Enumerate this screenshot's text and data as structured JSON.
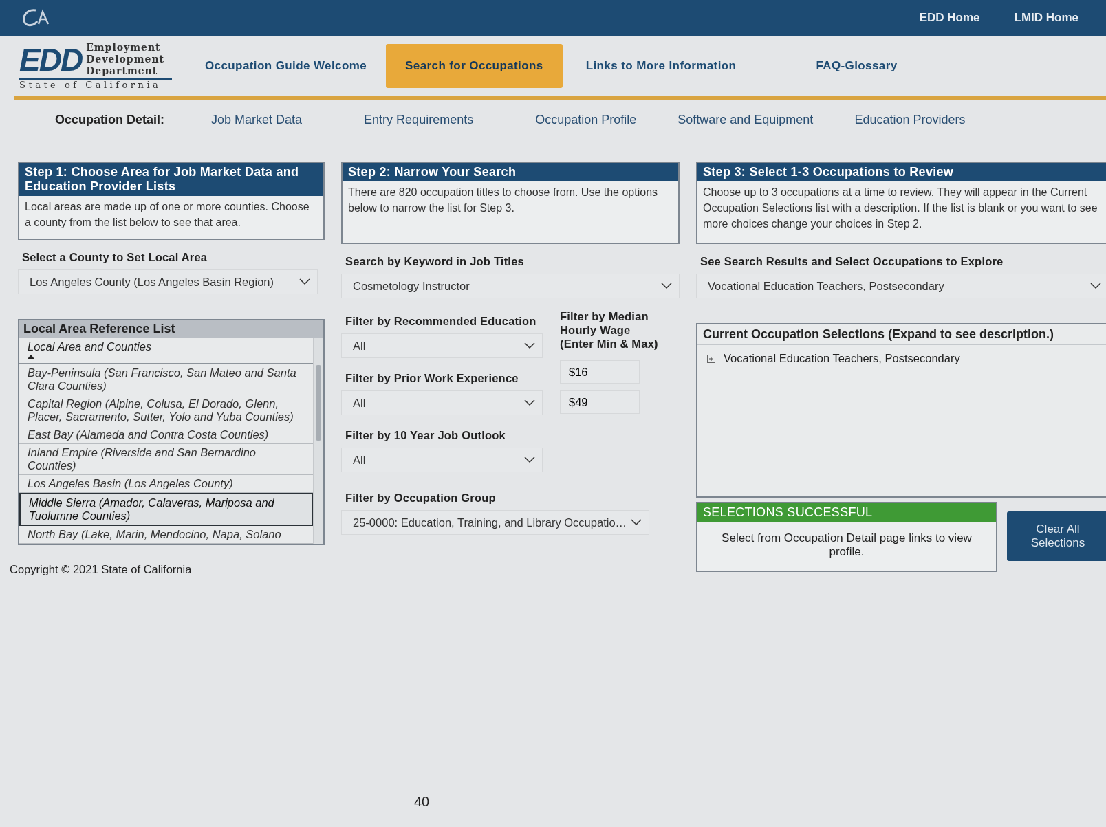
{
  "header": {
    "links": [
      "EDD Home",
      "LMID Home"
    ]
  },
  "logo": {
    "initials": "EDD",
    "lines": [
      "Employment",
      "Development",
      "Department"
    ],
    "tagline": "State of California"
  },
  "nav": [
    {
      "label": "Occupation Guide Welcome",
      "selected": false
    },
    {
      "label": "Search for Occupations",
      "selected": true
    },
    {
      "label": "Links to More Information",
      "selected": false
    },
    {
      "label": "FAQ-Glossary",
      "selected": false
    }
  ],
  "detail_nav": {
    "label": "Occupation Detail:",
    "links": [
      "Job Market Data",
      "Entry Requirements",
      "Occupation Profile",
      "Software and Equipment",
      "Education Providers"
    ]
  },
  "step1": {
    "title": "Step 1: Choose Area for Job Market Data and Education Provider Lists",
    "text": "Local areas are made up of one or more counties. Choose a county from the list below to see that area.",
    "county_label": "Select a County to Set Local Area",
    "county_value": "Los Angeles County (Los Angeles Basin Region)"
  },
  "reference_list": {
    "title": "Local Area Reference List",
    "column": "Local Area and Counties",
    "rows": [
      {
        "text": "Bay-Peninsula (San Francisco, San Mateo and Santa Clara Counties)",
        "selected": false
      },
      {
        "text": "Capital Region (Alpine, Colusa, El Dorado, Glenn, Placer, Sacramento, Sutter, Yolo and Yuba Counties)",
        "selected": false
      },
      {
        "text": "East Bay (Alameda and Contra Costa Counties)",
        "selected": false
      },
      {
        "text": "Inland Empire (Riverside and San Bernardino Counties)",
        "selected": false
      },
      {
        "text": "Los Angeles Basin (Los Angeles County)",
        "selected": false
      },
      {
        "text": "Middle Sierra (Amador, Calaveras, Mariposa and Tuolumne Counties)",
        "selected": true
      },
      {
        "text": "North Bay (Lake, Marin, Mendocino, Napa, Solano",
        "selected": false
      }
    ]
  },
  "step2": {
    "title": "Step 2: Narrow Your Search",
    "text": "There are 820 occupation titles to choose from.  Use the options below to narrow the list for Step 3.",
    "keyword_label": "Search by Keyword in Job Titles",
    "keyword_value": "Cosmetology Instructor",
    "filters": [
      {
        "label": "Filter by Recommended Education",
        "value": "All"
      },
      {
        "label": "Filter by Prior Work Experience",
        "value": "All"
      },
      {
        "label": "Filter by 10 Year Job Outlook",
        "value": "All"
      }
    ],
    "wage": {
      "label": "Filter by Median Hourly Wage (Enter Min & Max)",
      "min": "$16",
      "max": "$49"
    },
    "group_label": "Filter by Occupation Group",
    "group_value": "25-0000: Education, Training, and Library Occupatio…"
  },
  "step3": {
    "title": "Step 3: Select 1-3 Occupations to Review",
    "text": "Choose up to 3 occupations at a time to review. They will appear in the Current Occupation Selections list with a description.  If the list is blank or you want to see more choices change your choices in Step 2.",
    "results_label": "See Search Results and Select Occupations to Explore",
    "results_value": "Vocational Education Teachers, Postsecondary",
    "selections_title": "Current Occupation Selections (Expand to see description.)",
    "selections": [
      {
        "text": "Vocational Education Teachers, Postsecondary",
        "expanded": false
      }
    ],
    "status": {
      "title": "SELECTIONS SUCCESSFUL",
      "text": "Select from Occupation Detail page links to view profile."
    },
    "clear_button": "Clear All Selections"
  },
  "copyright": "Copyright © 2021 State of California",
  "page_number": "40"
}
